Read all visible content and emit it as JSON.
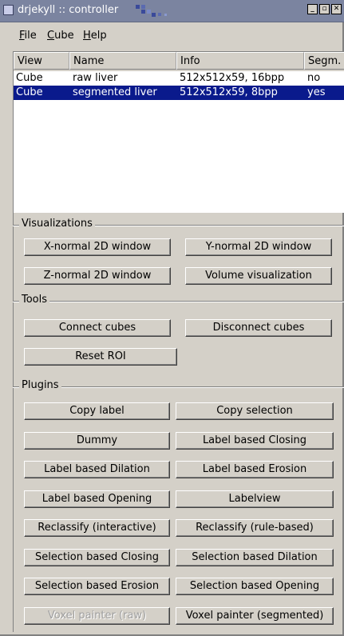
{
  "window": {
    "title": "drjekyll :: controller"
  },
  "menu": [
    {
      "label": "File",
      "mnemonic": "F",
      "rest": "ile"
    },
    {
      "label": "Cube",
      "mnemonic": "C",
      "rest": "ube"
    },
    {
      "label": "Help",
      "mnemonic": "H",
      "rest": "elp"
    }
  ],
  "table": {
    "columns": [
      "View",
      "Name",
      "Info",
      "Segm."
    ],
    "rows": [
      {
        "view": "Cube",
        "name": "raw liver",
        "info": "512x512x59, 16bpp",
        "segm": "no",
        "selected": false
      },
      {
        "view": "Cube",
        "name": "segmented liver",
        "info": "512x512x59, 8bpp",
        "segm": "yes",
        "selected": true
      }
    ]
  },
  "visualizations": {
    "title": "Visualizations",
    "buttons": [
      "X-normal 2D window",
      "Y-normal 2D window",
      "Z-normal 2D window",
      "Volume visualization"
    ]
  },
  "tools": {
    "title": "Tools",
    "buttons": [
      "Connect cubes",
      "Disconnect cubes",
      "Reset ROI"
    ]
  },
  "plugins": {
    "title": "Plugins",
    "buttons": [
      {
        "label": "Copy label",
        "enabled": true
      },
      {
        "label": "Copy selection",
        "enabled": true
      },
      {
        "label": "Dummy",
        "enabled": true
      },
      {
        "label": "Label based Closing",
        "enabled": true
      },
      {
        "label": "Label based Dilation",
        "enabled": true
      },
      {
        "label": "Label based Erosion",
        "enabled": true
      },
      {
        "label": "Label based Opening",
        "enabled": true
      },
      {
        "label": "Labelview",
        "enabled": true
      },
      {
        "label": "Reclassify (interactive)",
        "enabled": true
      },
      {
        "label": "Reclassify (rule-based)",
        "enabled": true
      },
      {
        "label": "Selection based Closing",
        "enabled": true
      },
      {
        "label": "Selection based Dilation",
        "enabled": true
      },
      {
        "label": "Selection based Erosion",
        "enabled": true
      },
      {
        "label": "Selection based Opening",
        "enabled": true
      },
      {
        "label": "Voxel painter (raw)",
        "enabled": false
      },
      {
        "label": "Voxel painter (segmented)",
        "enabled": true
      }
    ]
  },
  "colors": {
    "titlebar": "#7b84a0",
    "selection": "#0a1a8c",
    "face": "#d4d0c8"
  }
}
